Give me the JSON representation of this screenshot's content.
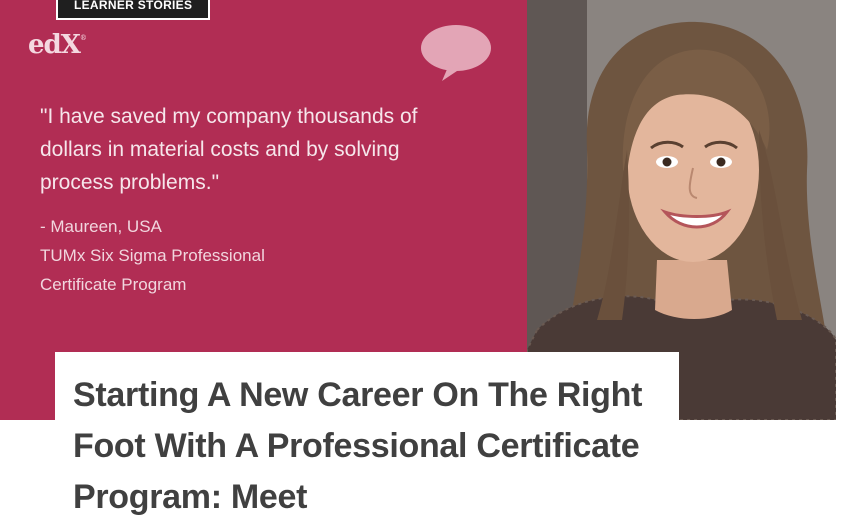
{
  "hero": {
    "tag": "LEARNER STORIES",
    "logo": "edX",
    "logo_mark": "®",
    "quote": "\"I have saved my company thousands of dollars in material costs and by solving process problems.\"",
    "attribution": [
      "- Maureen, USA",
      "TUMx Six Sigma Professional",
      "Certificate Program"
    ],
    "icons": {
      "bubble": "speech-bubble-icon"
    },
    "colors": {
      "panel": "#b12d54",
      "bubble": "#e3a5b6"
    }
  },
  "article": {
    "title": "Starting A New Career On The Right Foot With A Professional Certificate Program: Meet"
  }
}
